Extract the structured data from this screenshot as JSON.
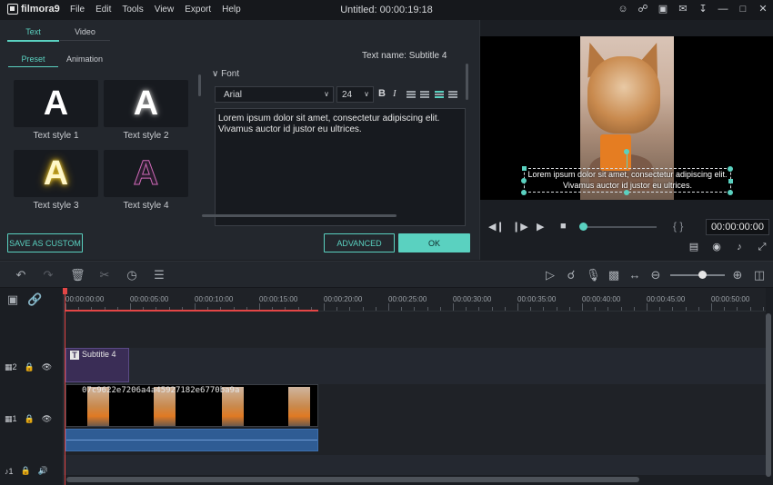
{
  "app": {
    "logo_text": "filmora9",
    "menu": [
      "File",
      "Edit",
      "Tools",
      "View",
      "Export",
      "Help"
    ],
    "title": "Untitled:",
    "title_time": "00:00:19:18",
    "title_icons": [
      "user-icon",
      "cart-icon",
      "save-icon",
      "mail-icon",
      "download-icon",
      "minimize-icon",
      "maximize-icon",
      "close-icon"
    ]
  },
  "editor": {
    "tabs": [
      "Text",
      "Video"
    ],
    "subtabs": [
      "Preset",
      "Animation"
    ],
    "text_name_label": "Text name: Subtitle 4",
    "styles": [
      "Text style 1",
      "Text style 2",
      "Text style 3",
      "Text style 4"
    ],
    "style_glyph": "A",
    "font_section": "Font",
    "font_family": "Arial",
    "font_size": "24",
    "bold": "B",
    "italic": "I",
    "text_content": "Lorem ipsum dolor sit amet, consectetur adipiscing elit. Vivamus auctor id justor eu ultrices.",
    "save_custom": "SAVE AS CUSTOM",
    "advanced": "ADVANCED",
    "ok": "OK"
  },
  "preview": {
    "subtitle": "Lorem ipsum dolor sit amet, consectetur adipiscing elit. Vivamus auctor id justor eu ultrices.",
    "timecode": "00:00:00:00",
    "brackets": "{ }",
    "seek_fraction": 0
  },
  "timeline": {
    "ruler_labels": [
      "00:00:00:00",
      "00:00:05:00",
      "00:00:10:00",
      "00:00:15:00",
      "00:00:20:00",
      "00:00:25:00",
      "00:00:30:00",
      "00:00:35:00",
      "00:00:40:00",
      "00:00:45:00",
      "00:00:50:00"
    ],
    "tracks": [
      "2",
      "1",
      "1"
    ],
    "subtitle_clip": "Subtitle 4",
    "subtitle_clip_icon": "T",
    "video_clip": "07c9622e7206a4a45927182e6770ba9a",
    "accent": "#5ad1c0",
    "playhead_color": "#e34646"
  }
}
